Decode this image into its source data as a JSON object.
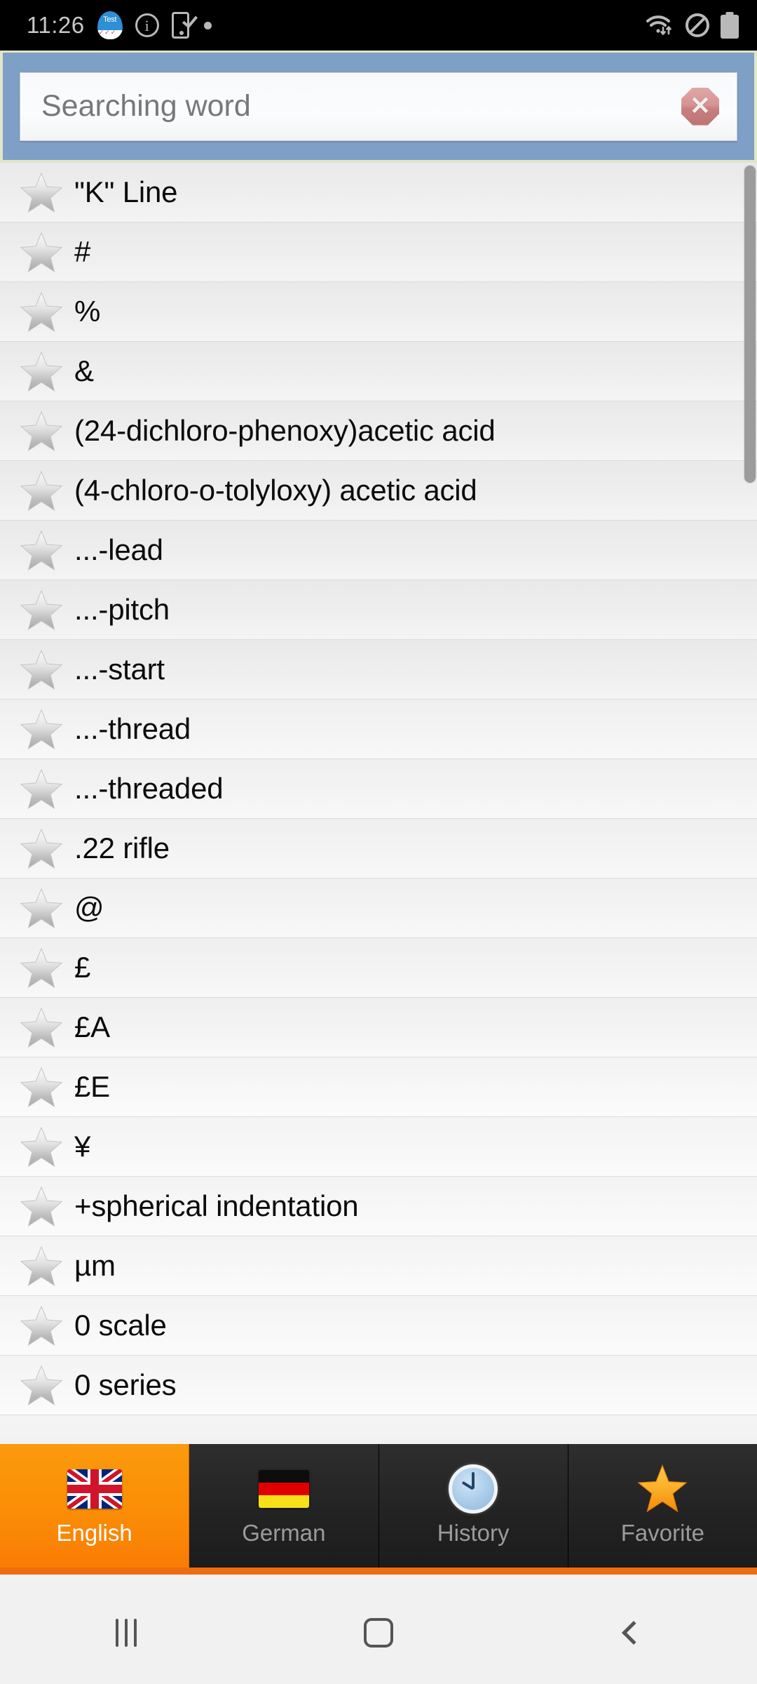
{
  "statusbar": {
    "time": "11:26",
    "left_icons": [
      {
        "name": "test-app-icon",
        "label": "Test"
      },
      {
        "name": "info-circle-icon",
        "glyph": "i"
      },
      {
        "name": "phone-check-icon"
      },
      {
        "name": "dot-indicator-icon"
      }
    ],
    "right_icons": [
      {
        "name": "wifi-data-icon"
      },
      {
        "name": "do-not-disturb-icon"
      },
      {
        "name": "battery-icon"
      }
    ]
  },
  "search": {
    "placeholder": "Searching word",
    "value": "",
    "clear_glyph": "✖",
    "clear_icon": "clear-octagon-icon",
    "header_bg": "#7fa0c6",
    "header_border": "#e3e4c8"
  },
  "list": {
    "items": [
      {
        "label": "\"K\" Line",
        "favorite": false
      },
      {
        "label": "#",
        "favorite": false
      },
      {
        "label": "%",
        "favorite": false
      },
      {
        "label": "&",
        "favorite": false
      },
      {
        "label": "(24-dichloro-phenoxy)acetic acid",
        "favorite": false
      },
      {
        "label": "(4-chloro-o-tolyloxy) acetic acid",
        "favorite": false
      },
      {
        "label": "...-lead",
        "favorite": false
      },
      {
        "label": "...-pitch",
        "favorite": false
      },
      {
        "label": "...-start",
        "favorite": false
      },
      {
        "label": "...-thread",
        "favorite": false
      },
      {
        "label": "...-threaded",
        "favorite": false
      },
      {
        "label": ".22 rifle",
        "favorite": false
      },
      {
        "label": "@",
        "favorite": false
      },
      {
        "label": "£",
        "favorite": false
      },
      {
        "label": "£A",
        "favorite": false
      },
      {
        "label": "£E",
        "favorite": false
      },
      {
        "label": "¥",
        "favorite": false
      },
      {
        "label": "+spherical indentation",
        "favorite": false
      },
      {
        "label": "µm",
        "favorite": false
      },
      {
        "label": "0 scale",
        "favorite": false
      },
      {
        "label": "0 series",
        "favorite": false
      }
    ],
    "star_icon": "favorite-star-outline-icon",
    "scrollbar": {
      "name": "vertical-scrollbar"
    }
  },
  "tabs": [
    {
      "label": "English",
      "icon": "uk-flag-icon",
      "active": true
    },
    {
      "label": "German",
      "icon": "german-flag-icon",
      "active": false
    },
    {
      "label": "History",
      "icon": "clock-icon",
      "active": false
    },
    {
      "label": "Favorite",
      "icon": "star-icon",
      "active": false
    }
  ],
  "tabbar": {
    "active_color": "#fb8f07",
    "inactive_color": "#262626",
    "accent_underline": "#ef6c10"
  },
  "navbar": {
    "buttons": [
      {
        "name": "recents-button",
        "icon": "recents-icon"
      },
      {
        "name": "home-button",
        "icon": "home-icon"
      },
      {
        "name": "back-button",
        "icon": "back-chevron-icon"
      }
    ]
  }
}
